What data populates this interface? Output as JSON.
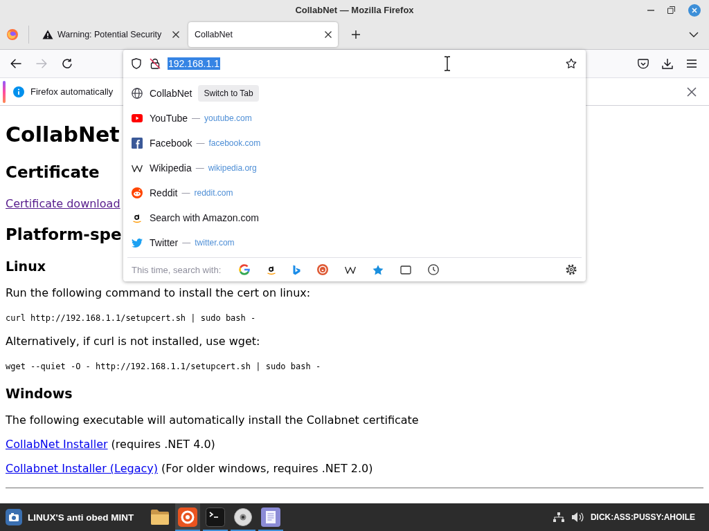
{
  "window": {
    "title": "CollabNet — Mozilla Firefox"
  },
  "tabs": [
    {
      "title": "Warning: Potential Security",
      "kind": "warning",
      "selected": false
    },
    {
      "title": "CollabNet",
      "kind": "page",
      "selected": true
    }
  ],
  "toolbar": {
    "nav": [
      {
        "kind": "back",
        "disabled": false
      },
      {
        "kind": "forward",
        "disabled": true
      },
      {
        "kind": "reload",
        "disabled": false
      }
    ]
  },
  "urlbar": {
    "value": "192.168.1.1",
    "text_selected": true,
    "suggestions": [
      {
        "kind": "tab",
        "title": "CollabNet",
        "action": "Switch to Tab"
      },
      {
        "kind": "site",
        "title": "YouTube",
        "separator": "—",
        "url": "youtube.com"
      },
      {
        "kind": "site",
        "title": "Facebook",
        "separator": "—",
        "url": "facebook.com"
      },
      {
        "kind": "site",
        "title": "Wikipedia",
        "separator": "—",
        "url": "wikipedia.org"
      },
      {
        "kind": "site",
        "title": "Reddit",
        "separator": "—",
        "url": "reddit.com"
      },
      {
        "kind": "search",
        "title": "Search with Amazon.com"
      },
      {
        "kind": "site",
        "title": "Twitter",
        "separator": "—",
        "url": "twitter.com"
      }
    ],
    "search_label": "This time, search with:"
  },
  "notification": {
    "text": "Firefox automatically"
  },
  "page": {
    "blocks": [
      {
        "kind": "h1",
        "text": "CollabNet"
      },
      {
        "kind": "h2",
        "text": "Certificate"
      },
      {
        "kind": "link",
        "text": "Certificate download",
        "visited": true
      },
      {
        "kind": "h2",
        "text": "Platform-spe"
      },
      {
        "kind": "h3",
        "text": "Linux"
      },
      {
        "kind": "p",
        "text": "Run the following command to install the cert on linux:"
      },
      {
        "kind": "code",
        "text": "curl http://192.168.1.1/setupcert.sh | sudo bash -"
      },
      {
        "kind": "p",
        "text": "Alternatively, if curl is not installed, use wget:"
      },
      {
        "kind": "code",
        "text": "wget --quiet -O - http://192.168.1.1/setupcert.sh | sudo bash -"
      },
      {
        "kind": "h3",
        "text": "Windows"
      },
      {
        "kind": "p",
        "text": "The following executable will automatically install the Collabnet certificate"
      },
      {
        "kind": "link",
        "text": "CollabNet Installer",
        "note": "(requires .NET 4.0)",
        "visited": false
      },
      {
        "kind": "link",
        "text": "Collabnet Installer (Legacy)",
        "note": "(For older windows, requires .NET 2.0)",
        "visited": false
      },
      {
        "kind": "hr"
      }
    ]
  },
  "taskbar": {
    "start_label": "LINUX'S anti obed MINT",
    "apps": [
      {
        "kind": "files",
        "active": false,
        "running": false
      },
      {
        "kind": "browser",
        "active": true,
        "running": true
      },
      {
        "kind": "terminal",
        "active": false,
        "running": true
      },
      {
        "kind": "disc",
        "active": false,
        "running": true
      },
      {
        "kind": "editor",
        "active": false,
        "running": true
      }
    ],
    "clock": "DICK:ASS:PUSSY:AHOILE"
  }
}
